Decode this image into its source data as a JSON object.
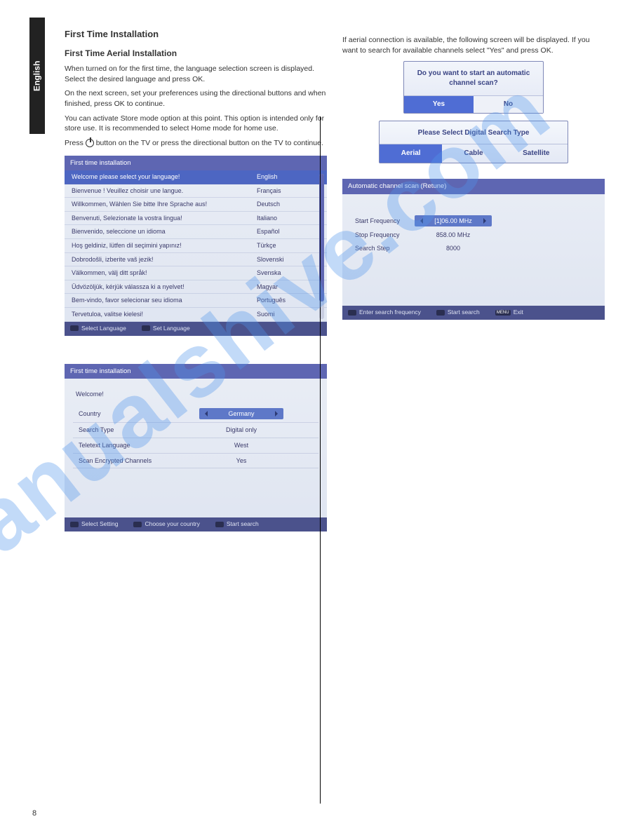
{
  "page": {
    "tab": "English",
    "number": "8",
    "section_title": "First Time Installation",
    "section_subtitle": "First Time Aerial Installation"
  },
  "watermark": "manualshive.com",
  "left": {
    "p1": "When turned on for the first time, the language selection screen is displayed. Select the desired language and press OK.",
    "p2": "On the next screen, set your preferences using the directional buttons and when finished, press OK to continue.",
    "p3": "You can activate Store mode option at this point. This option is intended only for store use. It is recommended to select Home mode for home use.",
    "p4": "Press ",
    "p4_cont": " button on the TV or press the directional button on the TV to continue."
  },
  "osd_lang": {
    "header": "First time installation",
    "rows": [
      {
        "l": "Welcome please select your language!",
        "r": "English"
      },
      {
        "l": "Bienvenue ! Veuillez choisir une langue.",
        "r": "Français"
      },
      {
        "l": "Willkommen, Wählen Sie bitte Ihre Sprache aus!",
        "r": "Deutsch"
      },
      {
        "l": "Benvenuti, Selezionate la vostra lingua!",
        "r": "Italiano"
      },
      {
        "l": "Bienvenido, seleccione un idioma",
        "r": "Español"
      },
      {
        "l": "Hoş geldiniz, lütfen dil seçimini yapınız!",
        "r": "Türkçe"
      },
      {
        "l": "Dobrodošli, izberite vaš jezik!",
        "r": "Slovenski"
      },
      {
        "l": "Välkommen, välj ditt språk!",
        "r": "Svenska"
      },
      {
        "l": "Üdvözöljük, kérjük válassza ki a nyelvet!",
        "r": "Magyar"
      },
      {
        "l": "Bem-vindo, favor selecionar seu idioma",
        "r": "Português"
      },
      {
        "l": "Tervetuloa, valitse kielesi!",
        "r": "Suomi"
      }
    ],
    "footer_left": "Select Language",
    "footer_right": "Set Language"
  },
  "osd_welcome": {
    "header": "First time installation",
    "welcome": "Welcome!",
    "rows": [
      {
        "label": "Country",
        "value": "Germany",
        "pill": true
      },
      {
        "label": "Search Type",
        "value": "Digital only"
      },
      {
        "label": "Teletext Language",
        "value": "West"
      },
      {
        "label": "Scan Encrypted Channels",
        "value": "Yes"
      }
    ],
    "footer": [
      "Select Setting",
      "Choose your country",
      "Start search"
    ]
  },
  "right": {
    "p1": "If aerial connection is available, the following screen will be displayed. If you want to search for available channels select \"Yes\" and press OK."
  },
  "dialog_scan": {
    "prompt": "Do you want to start an automatic channel scan?",
    "yes": "Yes",
    "no": "No"
  },
  "dialog_search_type": {
    "prompt": "Please Select Digital Search Type",
    "options": [
      "Aerial",
      "Cable",
      "Satellite"
    ]
  },
  "osd_scan": {
    "header": "Automatic channel scan (Retune)",
    "rows": [
      {
        "label": "Start Frequency",
        "value": "[1]06.00 MHz",
        "pill": true
      },
      {
        "label": "Stop Frequency",
        "value": "858.00 MHz"
      },
      {
        "label": "Search Step",
        "value": "8000"
      }
    ],
    "footer": [
      "Enter search frequency",
      "Start search",
      "Exit"
    ],
    "footer_menu": "MENU"
  }
}
